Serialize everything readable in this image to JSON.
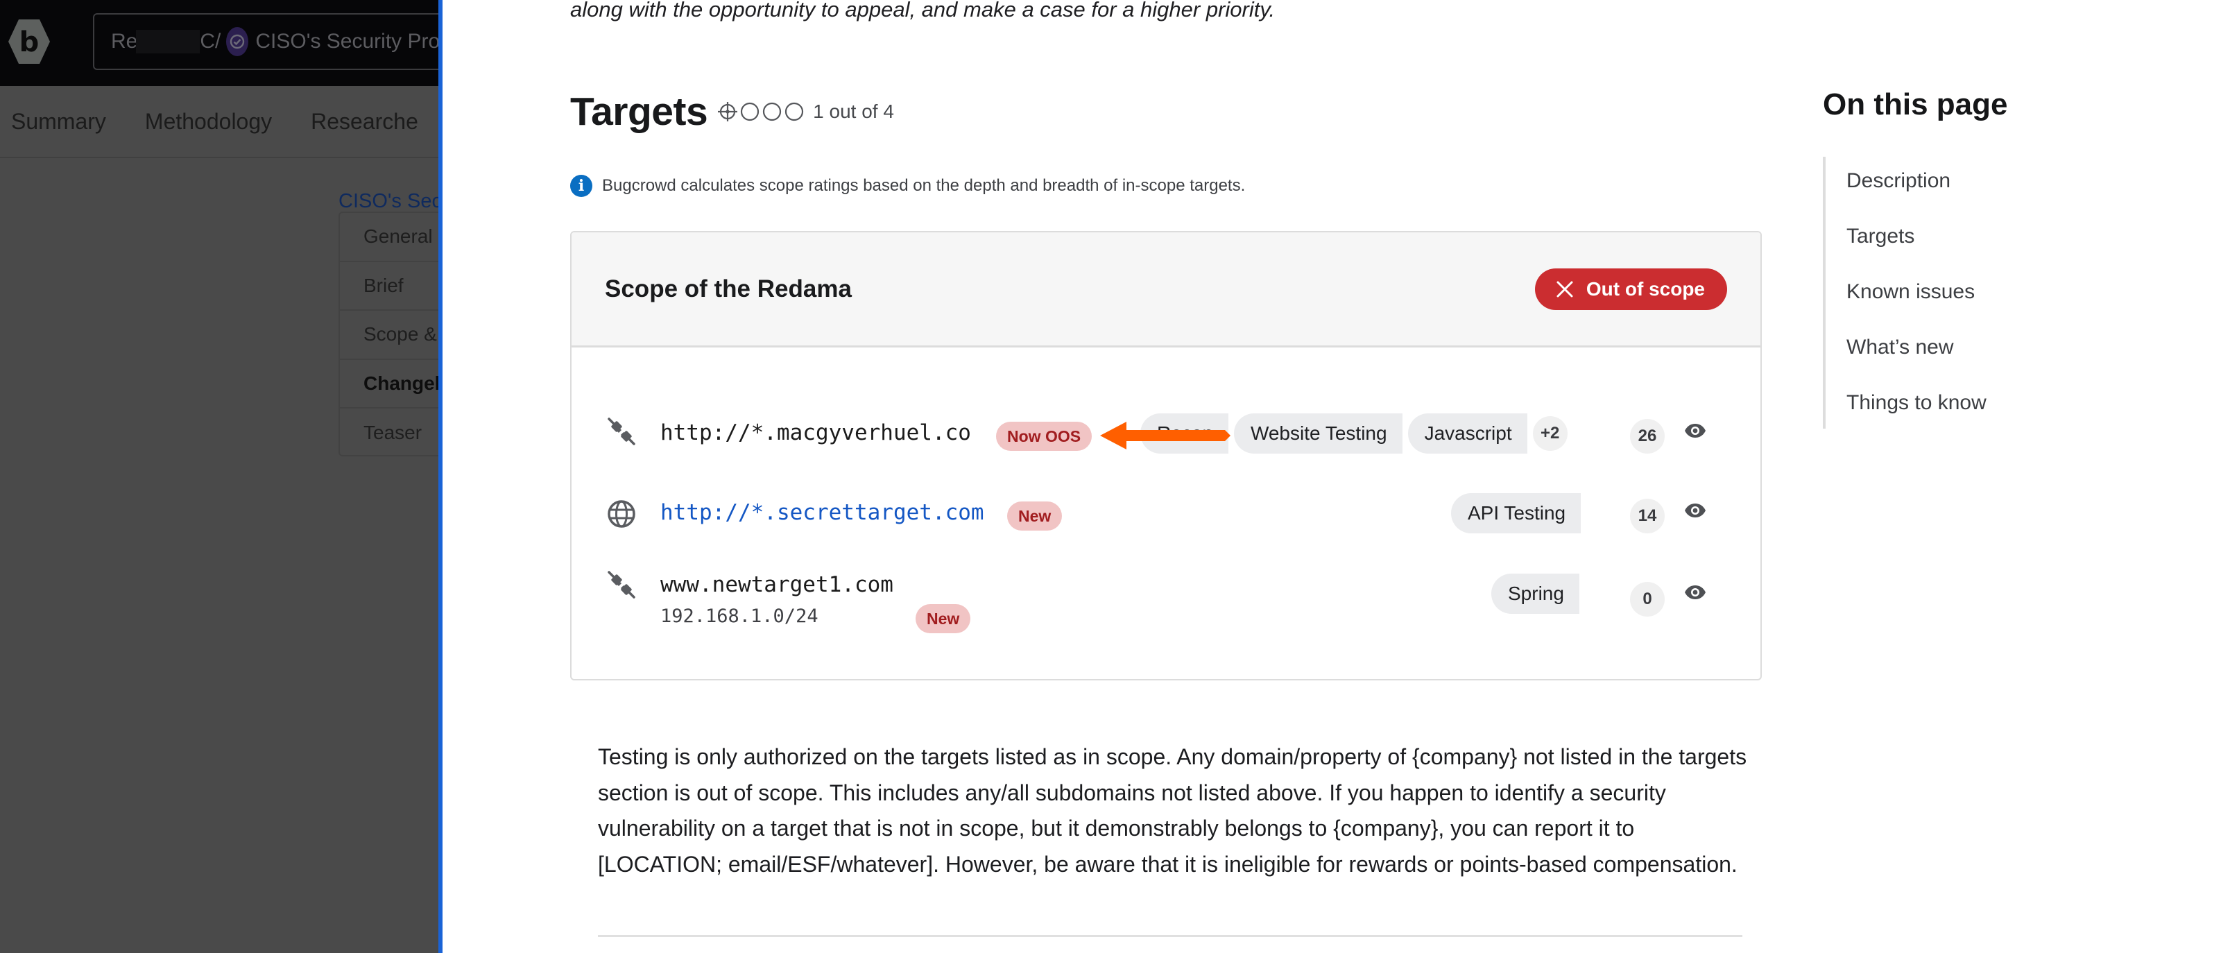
{
  "background_app": {
    "logo_letter": "b",
    "breadcrumb": {
      "org_visible_start": "Re",
      "org_visible_end": "C",
      "separator": "/",
      "program_name": "CISO's Security Pro"
    },
    "nav_tabs": [
      "Summary",
      "Methodology",
      "Researche"
    ],
    "page_link": "CISO's Sec",
    "side_nav": [
      {
        "label": "General",
        "active": false
      },
      {
        "label": "Brief",
        "active": false
      },
      {
        "label": "Scope &",
        "active": false
      },
      {
        "label": "Changel",
        "active": true
      },
      {
        "label": "Teaser",
        "active": false
      }
    ]
  },
  "panel": {
    "intro_text": "along with the opportunity to appeal, and make a case for a higher priority.",
    "targets": {
      "heading": "Targets",
      "rating": {
        "value": 1,
        "max": 4,
        "label": "1 out of 4"
      },
      "info_text": "Bugcrowd calculates scope ratings based on the depth and breadth of in-scope targets."
    },
    "scope_card": {
      "title": "Scope of the Redama",
      "status_button": "Out of scope",
      "status_color": "#cb2d30",
      "rows": [
        {
          "icon": "api-plug-icon",
          "url": "http://*.macgyverhuel.co",
          "is_link": false,
          "subtitle": "",
          "status_badge": "Now OOS",
          "tags": [
            "Recon",
            "Website Testing",
            "Javascript"
          ],
          "more_tags": "+2",
          "count": "26"
        },
        {
          "icon": "globe-icon",
          "url": "http://*.secrettarget.com",
          "is_link": true,
          "subtitle": "",
          "status_badge": "New",
          "tags": [
            "API Testing"
          ],
          "more_tags": "",
          "count": "14"
        },
        {
          "icon": "api-plug-icon",
          "url": "www.newtarget1.com",
          "is_link": false,
          "subtitle": "192.168.1.0/24",
          "status_badge": "New",
          "tags": [
            "Spring"
          ],
          "more_tags": "",
          "count": "0"
        }
      ]
    },
    "policy_text": "Testing is only authorized on the targets listed as in scope. Any domain/property of {company} not listed in the targets section is out of scope. This includes any/all subdomains not listed above. If you happen to identify a security vulnerability on a target that is not in scope, but it demonstrably belongs to {company}, you can report it to [LOCATION; email/ESF/whatever]. However, be aware that it is ineligible for rewards or points-based compensation."
  },
  "on_this_page": {
    "title": "On this page",
    "items": [
      "Description",
      "Targets",
      "Known issues",
      "What’s new",
      "Things to know"
    ]
  },
  "colors": {
    "accent_blue": "#1a63d6",
    "link_blue": "#1457c4",
    "danger_red": "#cb2d30",
    "badge_bg": "#f1c4c4",
    "badge_text": "#a11d1f",
    "annotation_arrow": "#ff5f00"
  }
}
